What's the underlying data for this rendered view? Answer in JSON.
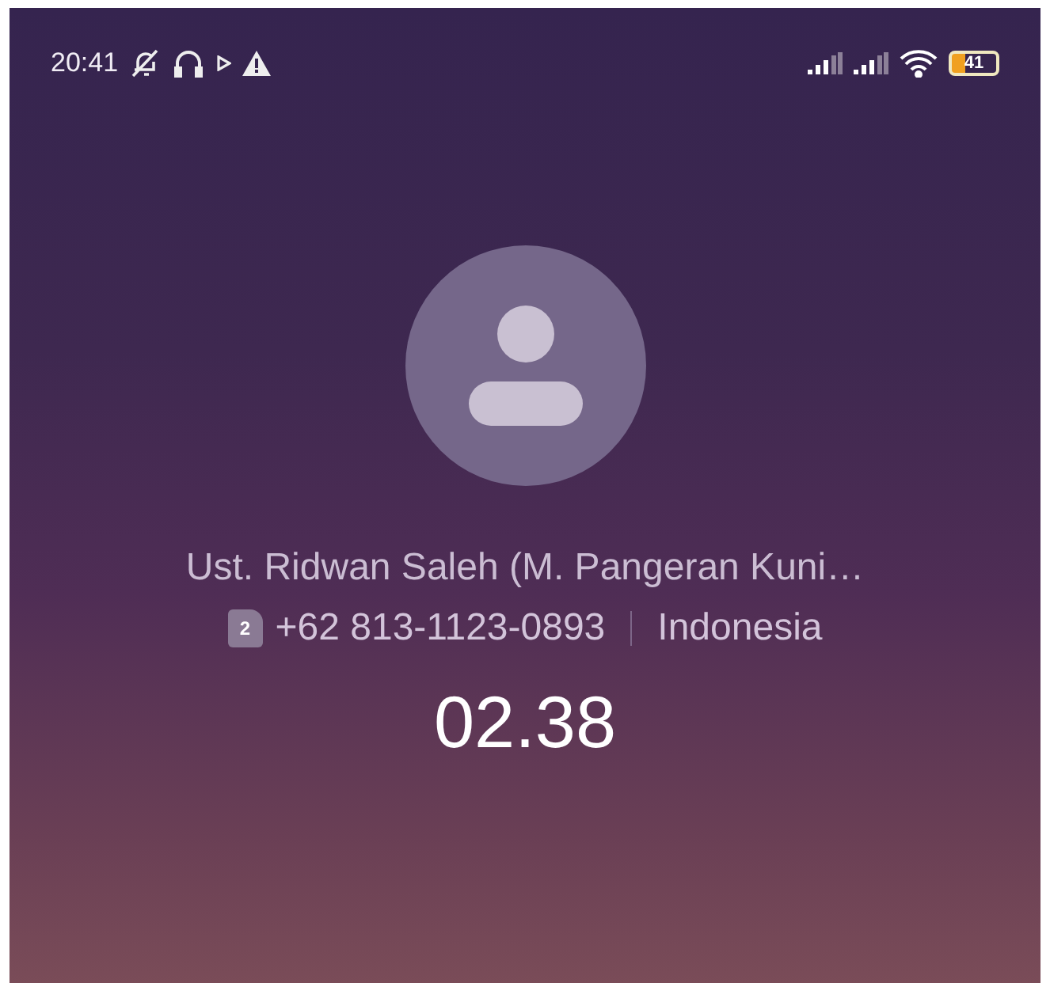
{
  "status_bar": {
    "time": "20:41",
    "battery": "41"
  },
  "call": {
    "name": "Ust. Ridwan Saleh (M. Pangeran Kuni…",
    "sim": "2",
    "number": "+62 813-1123-0893",
    "region": "Indonesia",
    "duration": "02.38"
  }
}
